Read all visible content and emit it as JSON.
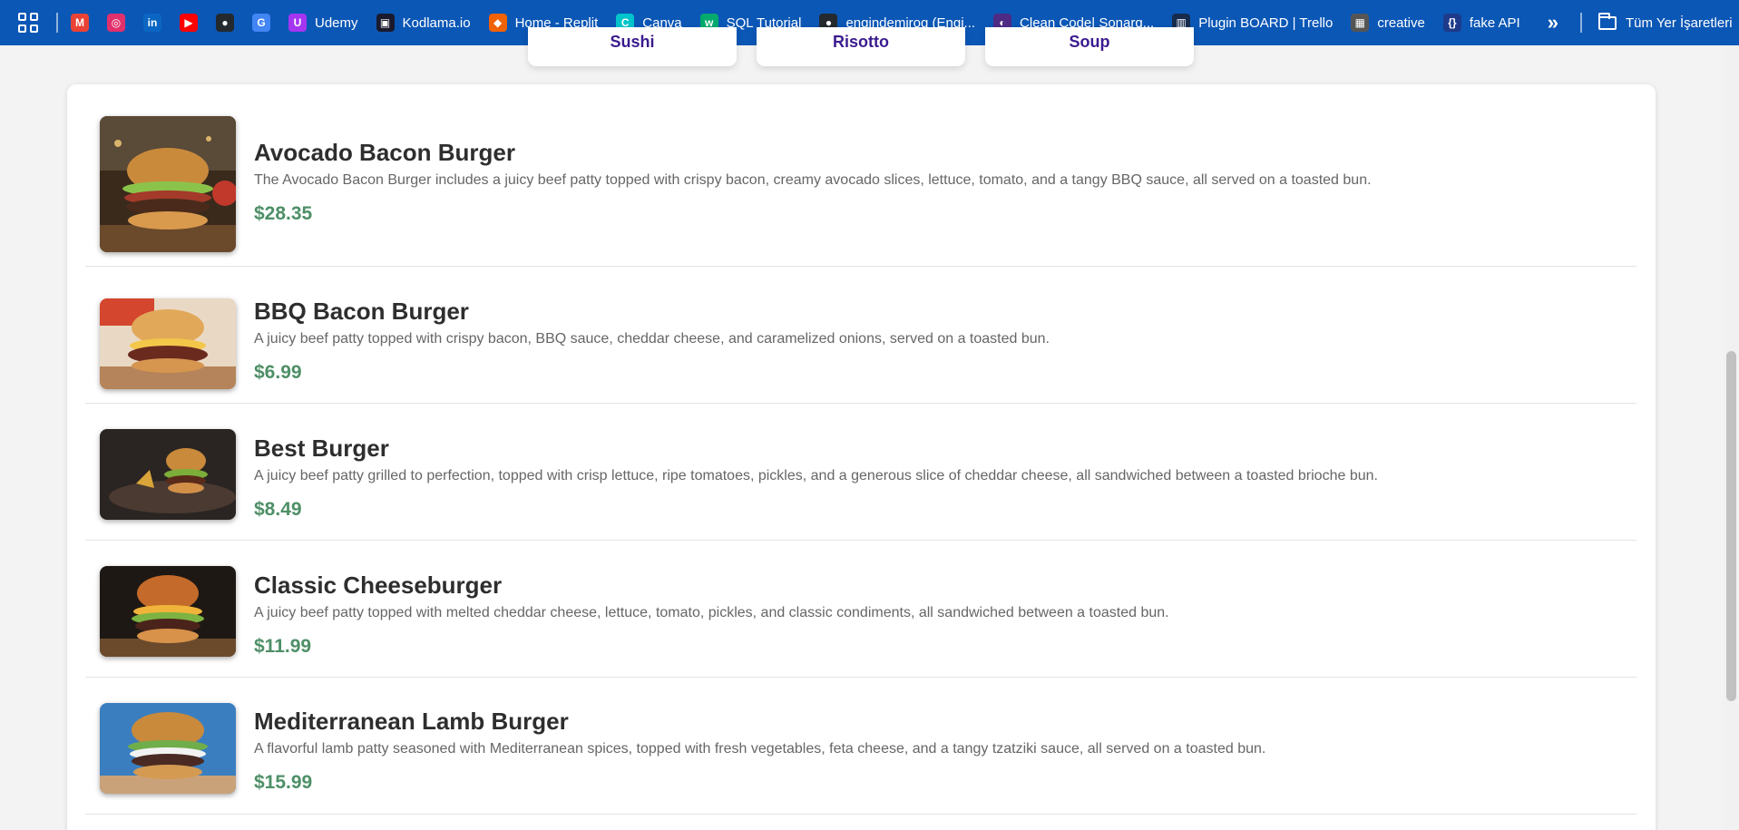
{
  "bookmarks": [
    {
      "name": "gmail",
      "label": "",
      "icon": "gmail-icon",
      "color": "#ea4335",
      "glyph": "M"
    },
    {
      "name": "instagram",
      "label": "",
      "icon": "instagram-icon",
      "color": "#e1306c",
      "glyph": "◎"
    },
    {
      "name": "linkedin",
      "label": "",
      "icon": "linkedin-icon",
      "color": "#0a66c2",
      "glyph": "in"
    },
    {
      "name": "youtube",
      "label": "",
      "icon": "youtube-icon",
      "color": "#ff0000",
      "glyph": "▶"
    },
    {
      "name": "github",
      "label": "",
      "icon": "github-icon",
      "color": "#24292e",
      "glyph": "●"
    },
    {
      "name": "translate",
      "label": "",
      "icon": "translate-icon",
      "color": "#4285f4",
      "glyph": "G"
    },
    {
      "name": "udemy",
      "label": "Udemy",
      "icon": "udemy-icon",
      "color": "#a435f0",
      "glyph": "U"
    },
    {
      "name": "kodlama",
      "label": "Kodlama.io",
      "icon": "kodlama-icon",
      "color": "#1a1a2e",
      "glyph": "▣"
    },
    {
      "name": "replit",
      "label": "Home - Replit",
      "icon": "replit-icon",
      "color": "#f26207",
      "glyph": "◆"
    },
    {
      "name": "canva",
      "label": "Canva",
      "icon": "canva-icon",
      "color": "#00c4cc",
      "glyph": "C"
    },
    {
      "name": "sql-tutorial",
      "label": "SQL Tutorial",
      "icon": "w3schools-icon",
      "color": "#04aa6d",
      "glyph": "w"
    },
    {
      "name": "github-engin",
      "label": "engindemirog (Engi...",
      "icon": "github-icon",
      "color": "#24292e",
      "glyph": "●"
    },
    {
      "name": "sonarqube",
      "label": "Clean Code| Sonarq...",
      "icon": "sonarqube-icon",
      "color": "#4e2a84",
      "glyph": "◐"
    },
    {
      "name": "trello",
      "label": "Plugin BOARD | Trello",
      "icon": "trello-icon",
      "color": "#172b4d",
      "glyph": "▥"
    },
    {
      "name": "creative",
      "label": "creative",
      "icon": "creative-icon",
      "color": "#555555",
      "glyph": "▦"
    },
    {
      "name": "fake-api",
      "label": "fake API",
      "icon": "fakeapi-icon",
      "color": "#1e3a8a",
      "glyph": "{}"
    }
  ],
  "bookmarks_more": "»",
  "all_bookmarks_label": "Tüm Yer İşaretleri",
  "category_tabs": [
    "Sushi",
    "Risotto",
    "Soup"
  ],
  "menu_items": [
    {
      "name": "Avocado Bacon Burger",
      "description": "The Avocado Bacon Burger includes a juicy beef patty topped with crispy bacon, creamy avocado slices, lettuce, tomato, and a tangy BBQ sauce, all served on a toasted bun.",
      "price": "$28.35"
    },
    {
      "name": "BBQ Bacon Burger",
      "description": "A juicy beef patty topped with crispy bacon, BBQ sauce, cheddar cheese, and caramelized onions, served on a toasted bun.",
      "price": "$6.99"
    },
    {
      "name": "Best Burger",
      "description": "A juicy beef patty grilled to perfection, topped with crisp lettuce, ripe tomatoes, pickles, and a generous slice of cheddar cheese, all sandwiched between a toasted brioche bun.",
      "price": "$8.49"
    },
    {
      "name": "Classic Cheeseburger",
      "description": "A juicy beef patty topped with melted cheddar cheese, lettuce, tomato, pickles, and classic condiments, all sandwiched between a toasted bun.",
      "price": "$11.99"
    },
    {
      "name": "Mediterranean Lamb Burger",
      "description": "A flavorful lamb patty seasoned with Mediterranean spices, topped with fresh vegetables, feta cheese, and a tangy tzatziki sauce, all served on a toasted bun.",
      "price": "$15.99"
    }
  ],
  "colors": {
    "bookmarks_bar": "#0b57b6",
    "price": "#4e8f67",
    "tab_text": "#3a1b8e",
    "item_name": "#2e2e2e"
  }
}
